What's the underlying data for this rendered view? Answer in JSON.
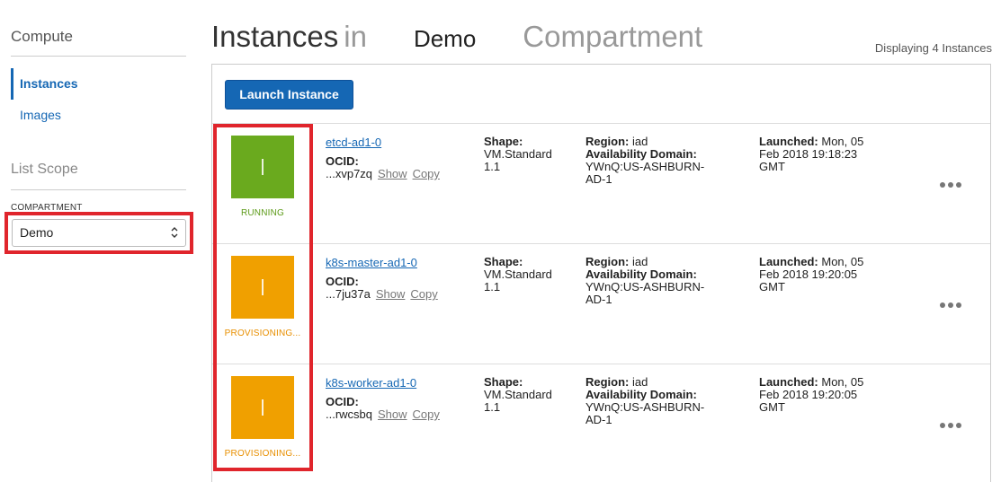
{
  "sidebar": {
    "heading": "Compute",
    "nav": [
      {
        "label": "Instances",
        "active": true
      },
      {
        "label": "Images",
        "active": false
      }
    ],
    "scope_heading": "List Scope",
    "compartment_label": "COMPARTMENT",
    "compartment_value": "Demo"
  },
  "header": {
    "title_part1": "Instances",
    "title_part2": "in",
    "title_compartment": "Demo",
    "title_part3": "Compartment",
    "display_count": "Displaying 4 Instances"
  },
  "toolbar": {
    "launch_label": "Launch Instance"
  },
  "colors": {
    "running": "#6aaa1e",
    "provisioning": "#f0a000",
    "accent": "#1567b4",
    "highlight": "#e0252c"
  },
  "labels": {
    "ocid": "OCID:",
    "show": "Show",
    "copy": "Copy",
    "shape": "Shape:",
    "region": "Region:",
    "ad": "Availability Domain:",
    "launched": "Launched:"
  },
  "instances": [
    {
      "name": "etcd-ad1-0",
      "status": "RUNNING",
      "status_color": "#6aaa1e",
      "status_text_color": "#5c9a18",
      "ocid_short": "...xvp7zq",
      "shape_line1": "VM.Standard",
      "shape_line2": "1.1",
      "region": "iad",
      "ad_line1": "YWnQ:US-ASHBURN-",
      "ad_line2": "AD-1",
      "launched_line1": "Mon, 05",
      "launched_line2": "Feb 2018 19:18:23",
      "launched_line3": "GMT"
    },
    {
      "name": "k8s-master-ad1-0",
      "status": "PROVISIONING...",
      "status_color": "#f0a000",
      "status_text_color": "#e88f00",
      "ocid_short": "...7ju37a",
      "shape_line1": "VM.Standard",
      "shape_line2": "1.1",
      "region": "iad",
      "ad_line1": "YWnQ:US-ASHBURN-",
      "ad_line2": "AD-1",
      "launched_line1": "Mon, 05",
      "launched_line2": "Feb 2018 19:20:05",
      "launched_line3": "GMT"
    },
    {
      "name": "k8s-worker-ad1-0",
      "status": "PROVISIONING...",
      "status_color": "#f0a000",
      "status_text_color": "#e88f00",
      "ocid_short": "...rwcsbq",
      "shape_line1": "VM.Standard",
      "shape_line2": "1.1",
      "region": "iad",
      "ad_line1": "YWnQ:US-ASHBURN-",
      "ad_line2": "AD-1",
      "launched_line1": "Mon, 05",
      "launched_line2": "Feb 2018 19:20:05",
      "launched_line3": "GMT"
    }
  ]
}
